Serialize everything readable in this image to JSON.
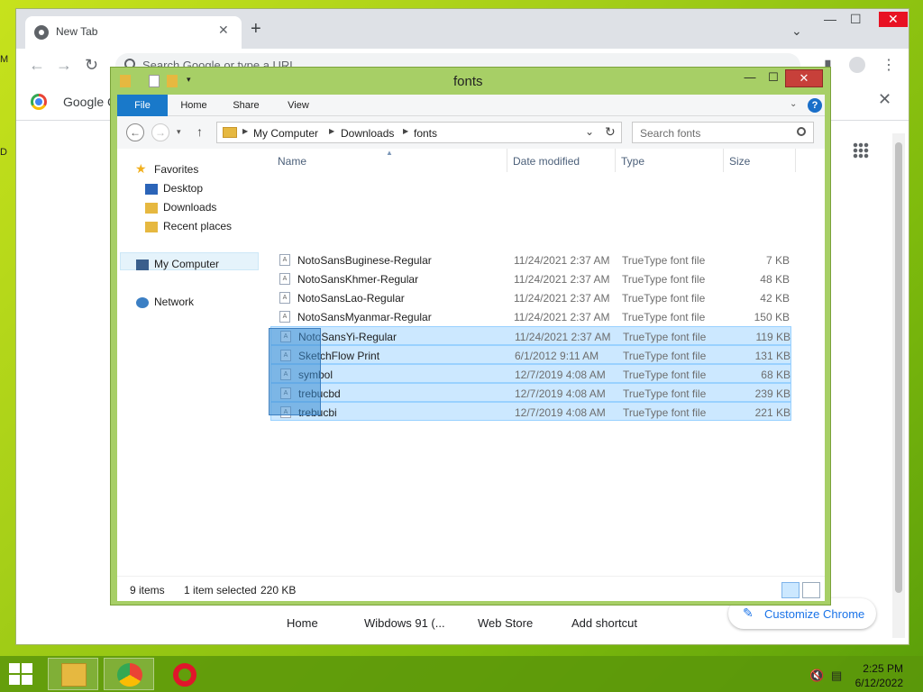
{
  "desktop": {
    "edge_letters": [
      "M",
      "D"
    ]
  },
  "chrome": {
    "tab_title": "New Tab",
    "tab_close": "✕",
    "new_tab": "+",
    "omnibox_placeholder": "Search Google or type a URL",
    "infobar_text": "Google C",
    "infobar_close": "✕",
    "window_controls": {
      "minimize": "—",
      "maximize": "☐",
      "close": "✕",
      "tab_search": "⌄"
    },
    "shortcuts": [
      "Home",
      "Wibdows 91 (...",
      "Web Store",
      "Add shortcut"
    ],
    "customize_label": "Customize Chrome"
  },
  "explorer": {
    "title": "fonts",
    "window_controls": {
      "minimize": "—",
      "maximize": "☐",
      "close": "✕"
    },
    "ribbon_tabs": [
      "File",
      "Home",
      "Share",
      "View"
    ],
    "help": "?",
    "address": {
      "crumbs": [
        "My Computer",
        "Downloads",
        "fonts"
      ]
    },
    "search_placeholder": "Search fonts",
    "nav": {
      "favorites_label": "Favorites",
      "favorites": [
        "Desktop",
        "Downloads",
        "Recent places"
      ],
      "computer_label": "My Computer",
      "network_label": "Network"
    },
    "columns": [
      "Name",
      "Date modified",
      "Type",
      "Size"
    ],
    "files": [
      {
        "name": "NotoSansBuginese-Regular",
        "date": "11/24/2021 2:37 AM",
        "type": "TrueType font file",
        "size": "7 KB",
        "selected": false
      },
      {
        "name": "NotoSansKhmer-Regular",
        "date": "11/24/2021 2:37 AM",
        "type": "TrueType font file",
        "size": "48 KB",
        "selected": false
      },
      {
        "name": "NotoSansLao-Regular",
        "date": "11/24/2021 2:37 AM",
        "type": "TrueType font file",
        "size": "42 KB",
        "selected": false
      },
      {
        "name": "NotoSansMyanmar-Regular",
        "date": "11/24/2021 2:37 AM",
        "type": "TrueType font file",
        "size": "150 KB",
        "selected": false
      },
      {
        "name": "NotoSansYi-Regular",
        "date": "11/24/2021 2:37 AM",
        "type": "TrueType font file",
        "size": "119 KB",
        "selected": true
      },
      {
        "name": "SketchFlow Print",
        "date": "6/1/2012 9:11 AM",
        "type": "TrueType font file",
        "size": "131 KB",
        "selected": true
      },
      {
        "name": "symbol",
        "date": "12/7/2019 4:08 AM",
        "type": "TrueType font file",
        "size": "68 KB",
        "selected": true
      },
      {
        "name": "trebucbd",
        "date": "12/7/2019 4:08 AM",
        "type": "TrueType font file",
        "size": "239 KB",
        "selected": true
      },
      {
        "name": "trebucbi",
        "date": "12/7/2019 4:08 AM",
        "type": "TrueType font file",
        "size": "221 KB",
        "selected": true
      }
    ],
    "status": {
      "items": "9 items",
      "selected": "1 item selected",
      "size": "220 KB"
    }
  },
  "taskbar": {
    "clock_time": "2:25 PM",
    "clock_date": "6/12/2022"
  },
  "colors": {
    "accent": "#1979ca",
    "selection": "#cce8ff",
    "window_frame": "#a7cf66"
  }
}
